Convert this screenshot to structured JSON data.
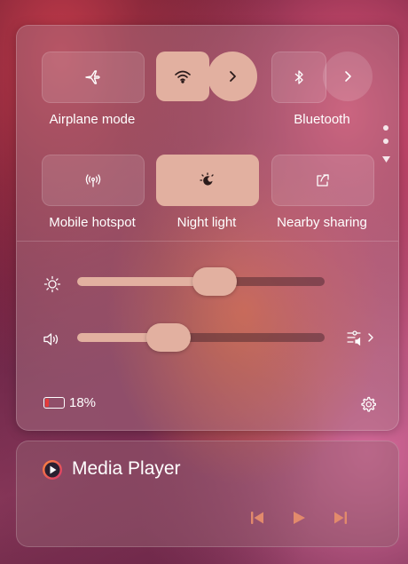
{
  "quick_settings": {
    "tiles": [
      {
        "label": "Airplane mode",
        "icon": "airplane-icon",
        "active": false
      },
      {
        "label": "",
        "icon": "wifi-icon",
        "active": true
      },
      {
        "label": "Bluetooth",
        "icon": "bluetooth-icon",
        "active": false
      },
      {
        "label": "Mobile hotspot",
        "icon": "hotspot-icon",
        "active": false
      },
      {
        "label": "Night light",
        "icon": "night-light-icon",
        "active": true
      },
      {
        "label": "Nearby sharing",
        "icon": "share-icon",
        "active": false
      }
    ],
    "brightness": {
      "icon": "sun-icon",
      "level": 0.5
    },
    "volume": {
      "icon": "speaker-icon",
      "level": 0.32
    },
    "battery": {
      "percent_label": "18%",
      "level": 0.18
    },
    "accent_color": "#e2b0a0"
  },
  "media": {
    "title": "Media Player",
    "controls": [
      "previous-icon",
      "play-icon",
      "next-icon"
    ]
  }
}
